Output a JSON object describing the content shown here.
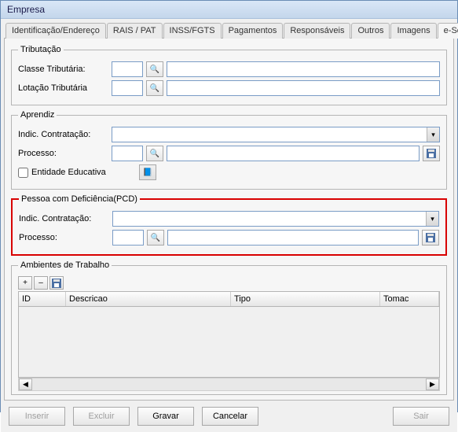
{
  "window": {
    "title": "Empresa"
  },
  "tabs": [
    {
      "label": "Identificação/Endereço",
      "active": false
    },
    {
      "label": "RAIS / PAT",
      "active": false
    },
    {
      "label": "INSS/FGTS",
      "active": false
    },
    {
      "label": "Pagamentos",
      "active": false
    },
    {
      "label": "Responsáveis",
      "active": false
    },
    {
      "label": "Outros",
      "active": false
    },
    {
      "label": "Imagens",
      "active": false
    },
    {
      "label": "e-Social",
      "active": true
    }
  ],
  "tributacao": {
    "legend": "Tributação",
    "classe_label": "Classe Tributária:",
    "classe_code": "",
    "classe_desc": "",
    "lotacao_label": "Lotação Tributária",
    "lotacao_code": "",
    "lotacao_desc": ""
  },
  "aprendiz": {
    "legend": "Aprendiz",
    "indic_label": "Indic. Contratação:",
    "indic_value": "",
    "processo_label": "Processo:",
    "processo_code": "",
    "processo_desc": "",
    "entidade_label": "Entidade Educativa",
    "entidade_checked": false
  },
  "pcd": {
    "legend": "Pessoa com Deficiência(PCD)",
    "indic_label": "Indic. Contratação:",
    "indic_value": "",
    "processo_label": "Processo:",
    "processo_code": "",
    "processo_desc": ""
  },
  "ambientes": {
    "legend": "Ambientes de Trabalho",
    "columns": {
      "id": "ID",
      "descricao": "Descricao",
      "tipo": "Tipo",
      "tomador": "Tomac"
    },
    "rows": []
  },
  "buttons": {
    "inserir": "Inserir",
    "excluir": "Excluir",
    "gravar": "Gravar",
    "cancelar": "Cancelar",
    "sair": "Sair"
  },
  "icons": {
    "binoculars": "🔍",
    "floppy": "💾",
    "book": "📘",
    "plus": "+",
    "minus": "–",
    "dropdown": "▾",
    "left": "◀",
    "right": "▶"
  }
}
